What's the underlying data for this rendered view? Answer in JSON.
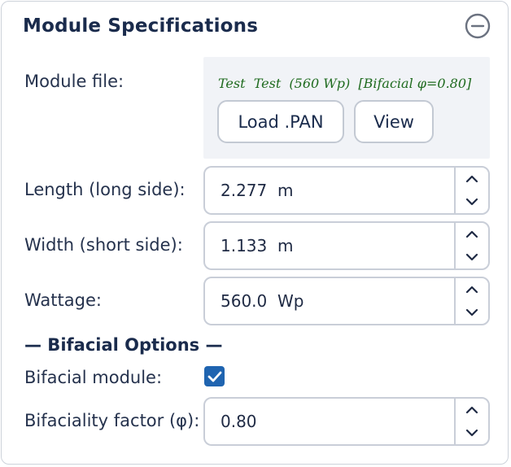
{
  "panel": {
    "title": "Module Specifications",
    "collapse_icon": "minus-circle-icon"
  },
  "module_file": {
    "label": "Module file:",
    "file_name": "Test  Test  (560 Wp)  [Bifacial φ=0.80]",
    "load_button": "Load .PAN",
    "view_button": "View"
  },
  "length": {
    "label": "Length (long side):",
    "value": "2.277  m"
  },
  "width": {
    "label": "Width (short side):",
    "value": "1.133  m"
  },
  "wattage": {
    "label": "Wattage:",
    "value": "560.0  Wp"
  },
  "bifacial": {
    "heading": "— Bifacial Options —",
    "module_label": "Bifacial module:",
    "module_checked": true,
    "factor_label": "Bifaciality factor (φ):",
    "factor_value": "0.80"
  },
  "colors": {
    "title": "#1a2b4c",
    "file_name": "#1f6b1f",
    "checkbox": "#1f64b0",
    "file_box_bg": "#f1f3f7"
  }
}
